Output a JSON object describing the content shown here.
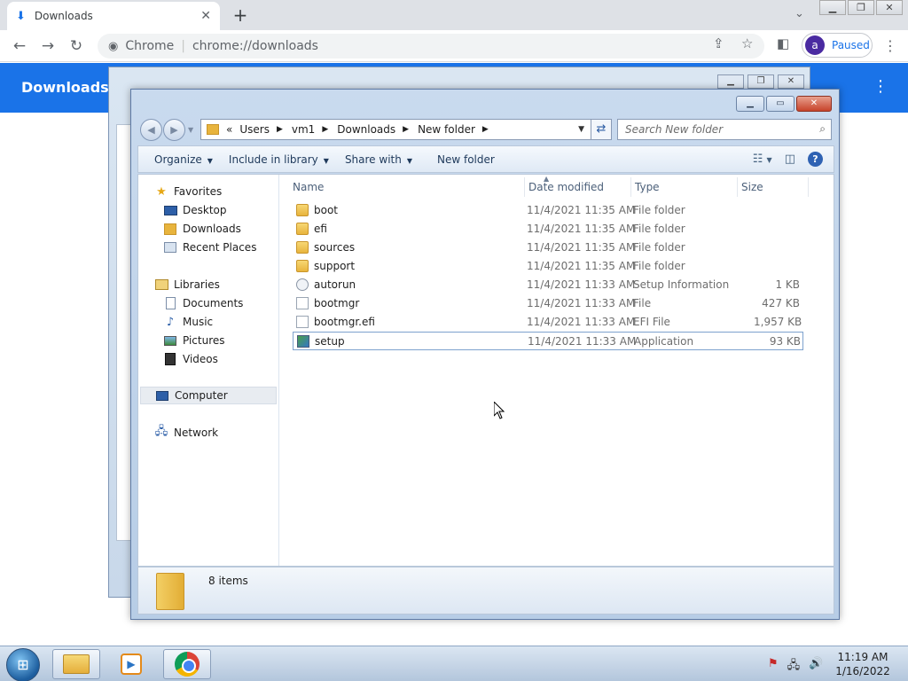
{
  "browser": {
    "tab_title": "Downloads",
    "tab_close": "✕",
    "new_tab": "+",
    "site_chip": "Chrome",
    "url": "chrome://downloads",
    "profile_initial": "a",
    "profile_status": "Paused"
  },
  "downloads_page": {
    "title": "Downloads"
  },
  "explorer": {
    "breadcrumb": [
      "Users",
      "vm1",
      "Downloads",
      "New folder"
    ],
    "breadcrumb_prefix": "«",
    "search_placeholder": "Search New folder",
    "commands": {
      "organize": "Organize",
      "include_in_library": "Include in library",
      "share_with": "Share with",
      "new_folder": "New folder"
    },
    "nav": {
      "favorites": "Favorites",
      "desktop": "Desktop",
      "downloads": "Downloads",
      "recent_places": "Recent Places",
      "libraries": "Libraries",
      "documents": "Documents",
      "music": "Music",
      "pictures": "Pictures",
      "videos": "Videos",
      "computer": "Computer",
      "network": "Network"
    },
    "columns": {
      "name": "Name",
      "date_modified": "Date modified",
      "type": "Type",
      "size": "Size"
    },
    "files": [
      {
        "name": "boot",
        "date": "11/4/2021 11:35 AM",
        "type": "File folder",
        "size": "",
        "icon": "folder-icon"
      },
      {
        "name": "efi",
        "date": "11/4/2021 11:35 AM",
        "type": "File folder",
        "size": "",
        "icon": "folder-icon"
      },
      {
        "name": "sources",
        "date": "11/4/2021 11:35 AM",
        "type": "File folder",
        "size": "",
        "icon": "folder-icon"
      },
      {
        "name": "support",
        "date": "11/4/2021 11:35 AM",
        "type": "File folder",
        "size": "",
        "icon": "folder-icon"
      },
      {
        "name": "autorun",
        "date": "11/4/2021 11:33 AM",
        "type": "Setup Information",
        "size": "1 KB",
        "icon": "settings-file-icon"
      },
      {
        "name": "bootmgr",
        "date": "11/4/2021 11:33 AM",
        "type": "File",
        "size": "427 KB",
        "icon": "file-icon"
      },
      {
        "name": "bootmgr.efi",
        "date": "11/4/2021 11:33 AM",
        "type": "EFI File",
        "size": "1,957 KB",
        "icon": "file-icon"
      },
      {
        "name": "setup",
        "date": "11/4/2021 11:33 AM",
        "type": "Application",
        "size": "93 KB",
        "icon": "setup-app-icon"
      }
    ],
    "status": {
      "items_count": "8 items"
    }
  },
  "taskbar": {
    "time": "11:19 AM",
    "date": "1/16/2022"
  },
  "colors": {
    "chrome_accent": "#1a73e8",
    "explorer_frame": "#b7cde6"
  }
}
